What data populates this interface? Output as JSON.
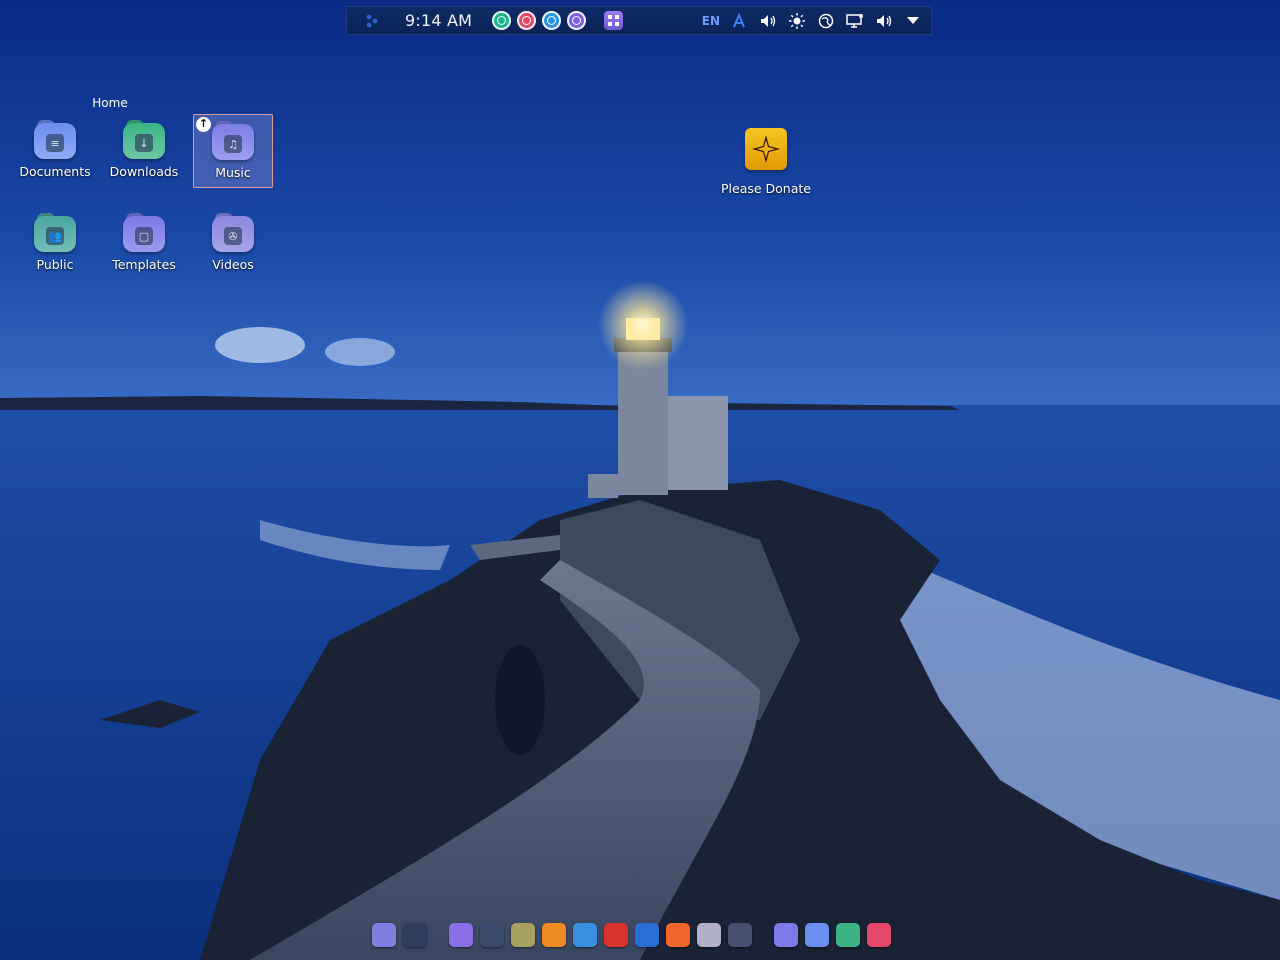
{
  "top_panel": {
    "clock": "9:14 AM",
    "quick_apps": [
      {
        "icon": "circle-app-icon",
        "color": "#1bb48a"
      },
      {
        "icon": "circle-app-icon",
        "color": "#e5476a"
      },
      {
        "icon": "circle-app-icon",
        "color": "#2a94e6"
      },
      {
        "icon": "circle-app-icon",
        "color": "#7c61e6"
      }
    ],
    "grid_app_icon": "app-grid-icon",
    "language": "EN",
    "tray_icons": [
      "text-input-icon",
      "volume-icon",
      "brightness-icon",
      "network-icon",
      "display-icon",
      "volume-icon",
      "chevron-down-icon"
    ]
  },
  "desktop": {
    "home_label": "Home",
    "icons": [
      {
        "id": "documents",
        "label": "Documents",
        "icon": "documents-folder-icon",
        "color": "#6c8ef0",
        "glyph": "≡"
      },
      {
        "id": "downloads",
        "label": "Downloads",
        "icon": "downloads-folder-icon",
        "color": "#3cb486",
        "glyph": "↓"
      },
      {
        "id": "music",
        "label": "Music",
        "icon": "music-folder-icon",
        "color": "#7d7ee8",
        "glyph": "♫",
        "selected": true
      },
      {
        "id": "public",
        "label": "Public",
        "icon": "public-folder-icon",
        "color": "#48a7a0",
        "glyph": "👥"
      },
      {
        "id": "templates",
        "label": "Templates",
        "icon": "templates-folder-icon",
        "color": "#7c7ae8",
        "glyph": "▢"
      },
      {
        "id": "videos",
        "label": "Videos",
        "icon": "videos-folder-icon",
        "color": "#8a87e0",
        "glyph": "✇"
      }
    ],
    "donate": {
      "label": "Please Donate",
      "icon": "compass-star-icon"
    }
  },
  "dock": {
    "items": [
      {
        "icon": "screenshot-app-icon",
        "color": "#7f7fe0"
      },
      {
        "icon": "workspace-switcher-icon",
        "color": "#2f3d5c"
      },
      {
        "icon": "file-manager-icon",
        "color": "#8a6fe8"
      },
      {
        "icon": "terminal-icon",
        "color": "#3a4a6a"
      },
      {
        "icon": "gimp-icon",
        "color": "#a8a060"
      },
      {
        "icon": "vlc-icon",
        "color": "#f08a24"
      },
      {
        "icon": "text-editor-icon",
        "color": "#3a8fe0"
      },
      {
        "icon": "filezilla-icon",
        "color": "#d8342c"
      },
      {
        "icon": "browser-icon",
        "color": "#2a6fd6"
      },
      {
        "icon": "firefox-icon",
        "color": "#f2682c"
      },
      {
        "icon": "chat-app-icon",
        "color": "#b0b0c8"
      },
      {
        "icon": "settings-icon",
        "color": "#46506e"
      },
      {
        "icon": "home-folder-icon",
        "color": "#7c7ae8"
      },
      {
        "icon": "documents-folder-icon",
        "color": "#6c8ef0"
      },
      {
        "icon": "downloads-folder-icon",
        "color": "#3cb486"
      },
      {
        "icon": "app-center-icon",
        "color": "#e5476a"
      }
    ]
  }
}
